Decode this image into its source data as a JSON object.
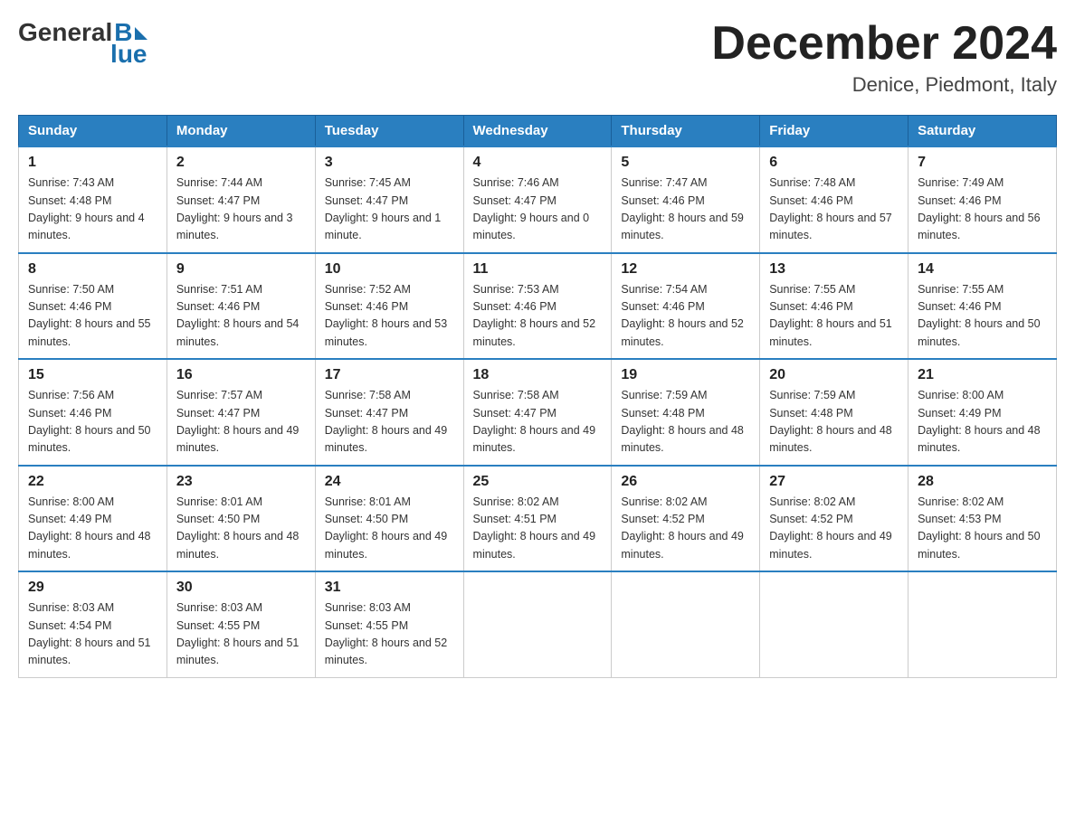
{
  "header": {
    "logo_general": "General",
    "logo_blue": "Blue",
    "month_title": "December 2024",
    "location": "Denice, Piedmont, Italy"
  },
  "days_of_week": [
    "Sunday",
    "Monday",
    "Tuesday",
    "Wednesday",
    "Thursday",
    "Friday",
    "Saturday"
  ],
  "weeks": [
    [
      {
        "day": "1",
        "sunrise": "7:43 AM",
        "sunset": "4:48 PM",
        "daylight": "9 hours and 4 minutes."
      },
      {
        "day": "2",
        "sunrise": "7:44 AM",
        "sunset": "4:47 PM",
        "daylight": "9 hours and 3 minutes."
      },
      {
        "day": "3",
        "sunrise": "7:45 AM",
        "sunset": "4:47 PM",
        "daylight": "9 hours and 1 minute."
      },
      {
        "day": "4",
        "sunrise": "7:46 AM",
        "sunset": "4:47 PM",
        "daylight": "9 hours and 0 minutes."
      },
      {
        "day": "5",
        "sunrise": "7:47 AM",
        "sunset": "4:46 PM",
        "daylight": "8 hours and 59 minutes."
      },
      {
        "day": "6",
        "sunrise": "7:48 AM",
        "sunset": "4:46 PM",
        "daylight": "8 hours and 57 minutes."
      },
      {
        "day": "7",
        "sunrise": "7:49 AM",
        "sunset": "4:46 PM",
        "daylight": "8 hours and 56 minutes."
      }
    ],
    [
      {
        "day": "8",
        "sunrise": "7:50 AM",
        "sunset": "4:46 PM",
        "daylight": "8 hours and 55 minutes."
      },
      {
        "day": "9",
        "sunrise": "7:51 AM",
        "sunset": "4:46 PM",
        "daylight": "8 hours and 54 minutes."
      },
      {
        "day": "10",
        "sunrise": "7:52 AM",
        "sunset": "4:46 PM",
        "daylight": "8 hours and 53 minutes."
      },
      {
        "day": "11",
        "sunrise": "7:53 AM",
        "sunset": "4:46 PM",
        "daylight": "8 hours and 52 minutes."
      },
      {
        "day": "12",
        "sunrise": "7:54 AM",
        "sunset": "4:46 PM",
        "daylight": "8 hours and 52 minutes."
      },
      {
        "day": "13",
        "sunrise": "7:55 AM",
        "sunset": "4:46 PM",
        "daylight": "8 hours and 51 minutes."
      },
      {
        "day": "14",
        "sunrise": "7:55 AM",
        "sunset": "4:46 PM",
        "daylight": "8 hours and 50 minutes."
      }
    ],
    [
      {
        "day": "15",
        "sunrise": "7:56 AM",
        "sunset": "4:46 PM",
        "daylight": "8 hours and 50 minutes."
      },
      {
        "day": "16",
        "sunrise": "7:57 AM",
        "sunset": "4:47 PM",
        "daylight": "8 hours and 49 minutes."
      },
      {
        "day": "17",
        "sunrise": "7:58 AM",
        "sunset": "4:47 PM",
        "daylight": "8 hours and 49 minutes."
      },
      {
        "day": "18",
        "sunrise": "7:58 AM",
        "sunset": "4:47 PM",
        "daylight": "8 hours and 49 minutes."
      },
      {
        "day": "19",
        "sunrise": "7:59 AM",
        "sunset": "4:48 PM",
        "daylight": "8 hours and 48 minutes."
      },
      {
        "day": "20",
        "sunrise": "7:59 AM",
        "sunset": "4:48 PM",
        "daylight": "8 hours and 48 minutes."
      },
      {
        "day": "21",
        "sunrise": "8:00 AM",
        "sunset": "4:49 PM",
        "daylight": "8 hours and 48 minutes."
      }
    ],
    [
      {
        "day": "22",
        "sunrise": "8:00 AM",
        "sunset": "4:49 PM",
        "daylight": "8 hours and 48 minutes."
      },
      {
        "day": "23",
        "sunrise": "8:01 AM",
        "sunset": "4:50 PM",
        "daylight": "8 hours and 48 minutes."
      },
      {
        "day": "24",
        "sunrise": "8:01 AM",
        "sunset": "4:50 PM",
        "daylight": "8 hours and 49 minutes."
      },
      {
        "day": "25",
        "sunrise": "8:02 AM",
        "sunset": "4:51 PM",
        "daylight": "8 hours and 49 minutes."
      },
      {
        "day": "26",
        "sunrise": "8:02 AM",
        "sunset": "4:52 PM",
        "daylight": "8 hours and 49 minutes."
      },
      {
        "day": "27",
        "sunrise": "8:02 AM",
        "sunset": "4:52 PM",
        "daylight": "8 hours and 49 minutes."
      },
      {
        "day": "28",
        "sunrise": "8:02 AM",
        "sunset": "4:53 PM",
        "daylight": "8 hours and 50 minutes."
      }
    ],
    [
      {
        "day": "29",
        "sunrise": "8:03 AM",
        "sunset": "4:54 PM",
        "daylight": "8 hours and 51 minutes."
      },
      {
        "day": "30",
        "sunrise": "8:03 AM",
        "sunset": "4:55 PM",
        "daylight": "8 hours and 51 minutes."
      },
      {
        "day": "31",
        "sunrise": "8:03 AM",
        "sunset": "4:55 PM",
        "daylight": "8 hours and 52 minutes."
      },
      null,
      null,
      null,
      null
    ]
  ]
}
